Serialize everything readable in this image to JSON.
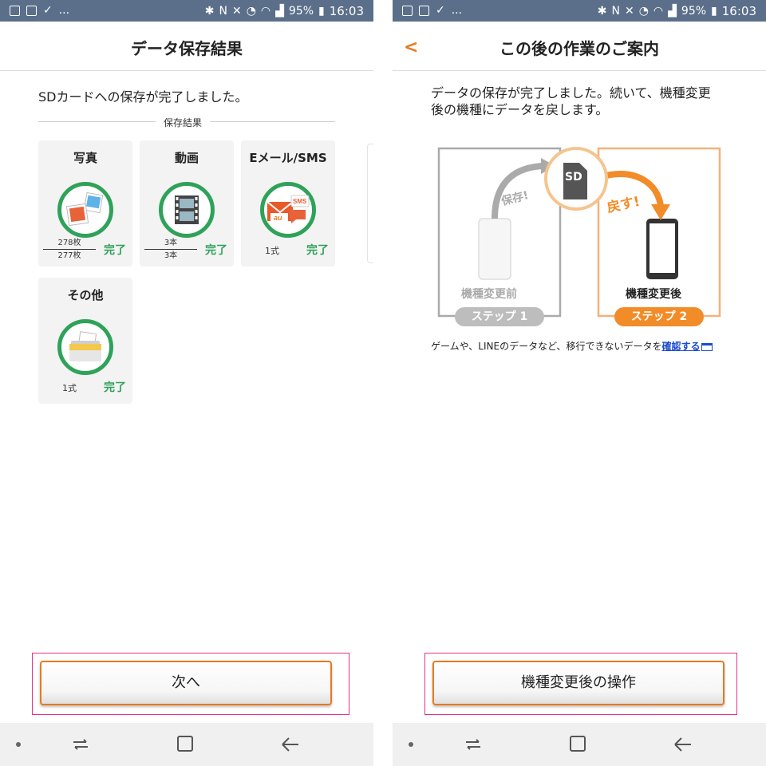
{
  "status": {
    "battery": "95%",
    "time": "16:03",
    "more": "..."
  },
  "left": {
    "title": "データ保存結果",
    "message": "SDカードへの保存が完了しました。",
    "section_label": "保存結果",
    "cards": [
      {
        "title": "写真",
        "count_top": "278枚",
        "count_bottom": "277枚",
        "status": "完了",
        "icon": "photo-icon"
      },
      {
        "title": "動画",
        "count_top": "3本",
        "count_bottom": "3本",
        "status": "完了",
        "icon": "film-icon"
      },
      {
        "title": "Eメール/SMS",
        "count": "1式",
        "status": "完了",
        "icon": "mail-icon",
        "icon_text_1": "SMS",
        "icon_text_2": "au"
      },
      {
        "title": "その他",
        "count": "1式",
        "status": "完了",
        "icon": "folder-icon"
      }
    ],
    "next_button": "次へ"
  },
  "right": {
    "title": "この後の作業のご案内",
    "message": "データの保存が完了しました。続いて、機種変更後の機種にデータを戻します。",
    "sd_label": "SD",
    "save_tag": "保存!",
    "restore_tag": "戻す!",
    "before_label": "機種変更前",
    "after_label": "機種変更後",
    "step1": "ステップ 1",
    "step2": "ステップ 2",
    "note_text": "ゲームや、LINEのデータなど、移行できないデータを",
    "note_link": "確認する",
    "operate_button": "機種変更後の操作"
  },
  "colors": {
    "accent": "#e8791f",
    "success": "#2fa25a",
    "status_bar": "#5b6f8a",
    "link": "#1a4bd0",
    "highlight": "#e3318a"
  }
}
